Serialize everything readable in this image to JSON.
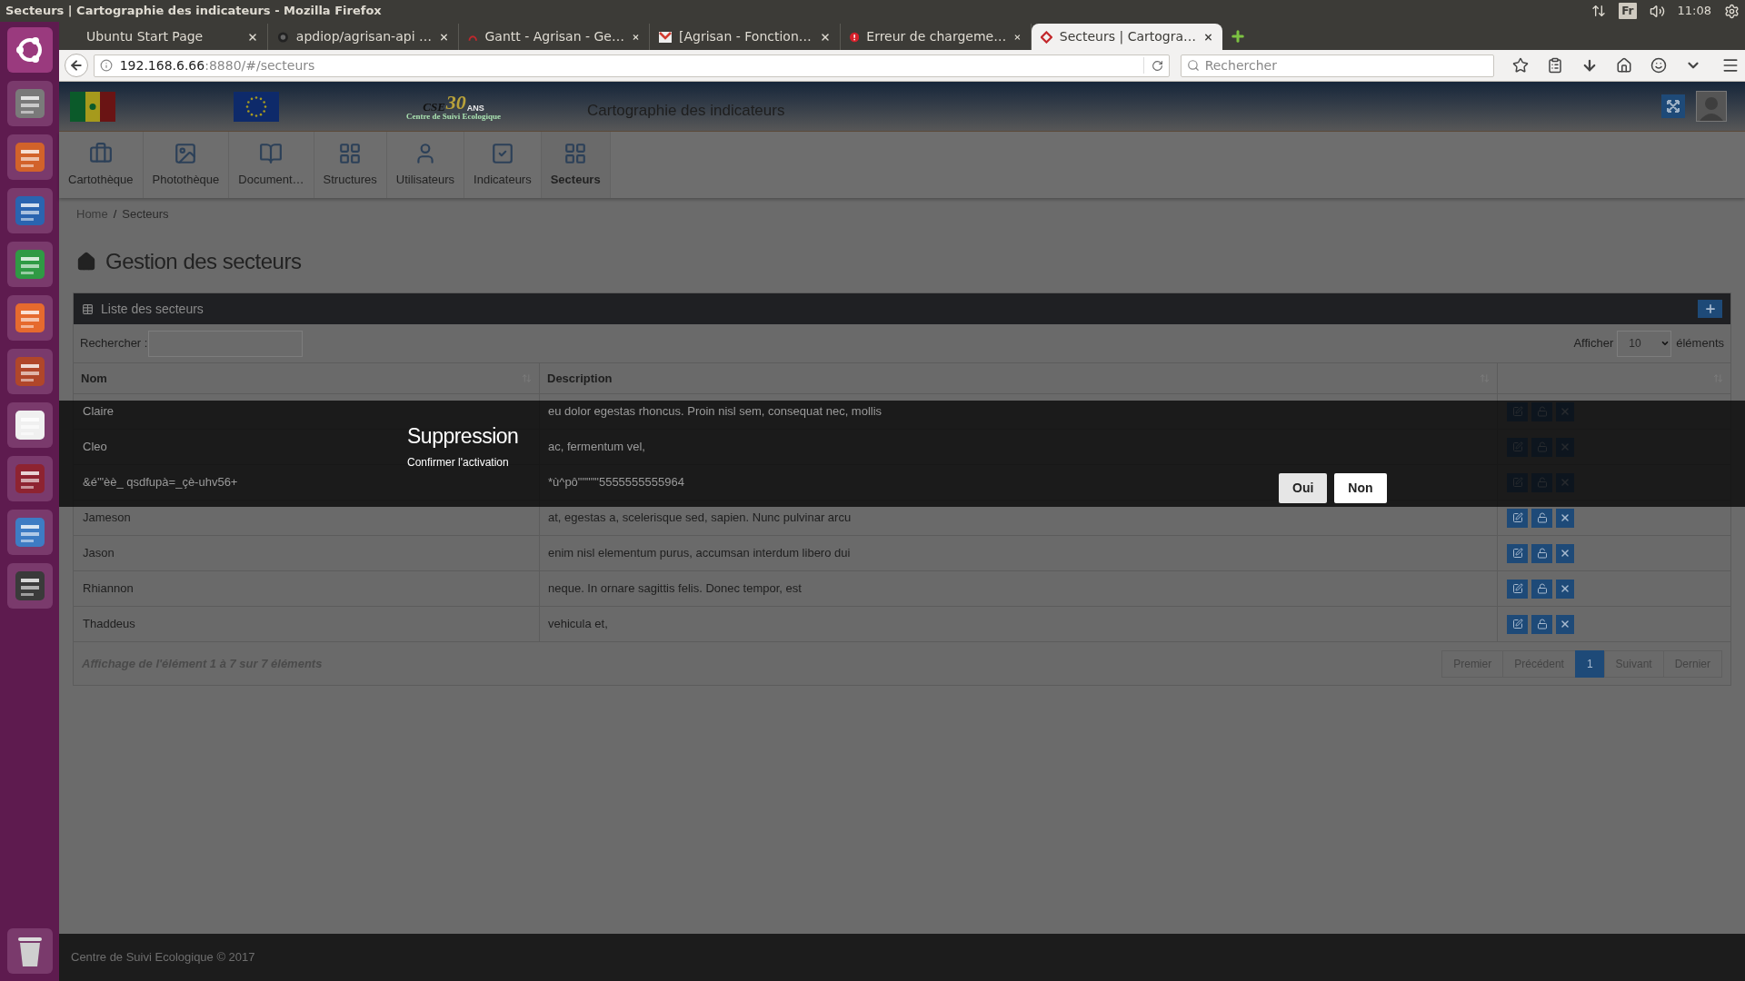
{
  "system_bar": {
    "window_title": "Secteurs | Cartographie des indicateurs - Mozilla Firefox",
    "keyboard": "Fr",
    "time": "11:08"
  },
  "browser": {
    "tabs": [
      {
        "title": "Ubuntu Start Page",
        "selected": false,
        "kind": "blank"
      },
      {
        "title": "apdiop/agrisan-api …",
        "selected": false,
        "kind": "repo"
      },
      {
        "title": "Gantt - Agrisan - Ge…",
        "selected": false,
        "kind": "arc"
      },
      {
        "title": "[Agrisan - Fonction…",
        "selected": false,
        "kind": "mail"
      },
      {
        "title": "Erreur de chargeme…",
        "selected": false,
        "kind": "error"
      },
      {
        "title": "Secteurs | Cartogra…",
        "selected": true,
        "kind": "site"
      }
    ],
    "url_host": "192.168.6.66",
    "url_rest": ":8880/#/secteurs",
    "search_placeholder": "Rechercher"
  },
  "app": {
    "logo": {
      "text": "CSE",
      "badge": "30",
      "suffix": "ANS",
      "caption": "Centre de Suivi Ecologique"
    },
    "title": "Cartographie des indicateurs",
    "nav": [
      {
        "label": "Cartothèque",
        "kind": "briefcase",
        "selected": false
      },
      {
        "label": "Photothèque",
        "kind": "image",
        "selected": false
      },
      {
        "label": "Document…",
        "kind": "book",
        "selected": false
      },
      {
        "label": "Structures",
        "kind": "grid",
        "selected": false
      },
      {
        "label": "Utilisateurs",
        "kind": "user",
        "selected": false
      },
      {
        "label": "Indicateurs",
        "kind": "check",
        "selected": false
      },
      {
        "label": "Secteurs",
        "kind": "grid",
        "selected": true
      }
    ],
    "breadcrumb": [
      "Home",
      "Secteurs"
    ],
    "breadcrumb_separator": "/",
    "page_title": "Gestion des secteurs",
    "panel": {
      "title": "Liste des secteurs",
      "search_label": "Rechercher :",
      "show_label": "Afficher",
      "page_size": "10",
      "show_suffix": "éléments",
      "columns": [
        "Nom",
        "Description"
      ],
      "rows": [
        {
          "nom": "Claire",
          "description": "eu dolor egestas rhoncus. Proin nisl sem, consequat nec, mollis"
        },
        {
          "nom": "Cleo",
          "description": "ac, fermentum vel,"
        },
        {
          "nom": "&é'\"èè_ qsdfupà=_çè-uhv56+",
          "description": "*ù^pô\"\"\"\"\"5555555555964"
        },
        {
          "nom": "Jameson",
          "description": "at, egestas a, scelerisque sed, sapien. Nunc pulvinar arcu"
        },
        {
          "nom": "Jason",
          "description": "enim nisl elementum purus, accumsan interdum libero dui"
        },
        {
          "nom": "Rhiannon",
          "description": "neque. In ornare sagittis felis. Donec tempor, est"
        },
        {
          "nom": "Thaddeus",
          "description": "vehicula et,"
        }
      ],
      "info": "Affichage de l'élément 1 à 7 sur 7 éléments",
      "pagination": [
        {
          "label": "Premier",
          "selected": false
        },
        {
          "label": "Précédent",
          "selected": false
        },
        {
          "label": "1",
          "selected": true
        },
        {
          "label": "Suivant",
          "selected": false
        },
        {
          "label": "Dernier",
          "selected": false
        }
      ]
    },
    "modal": {
      "title": "Suppression",
      "message": "Confirmer l'activation",
      "buttons": [
        {
          "label": "Oui",
          "selected": true
        },
        {
          "label": "Non",
          "selected": false
        }
      ]
    },
    "footer": "Centre de Suivi Ecologique © 2017"
  }
}
